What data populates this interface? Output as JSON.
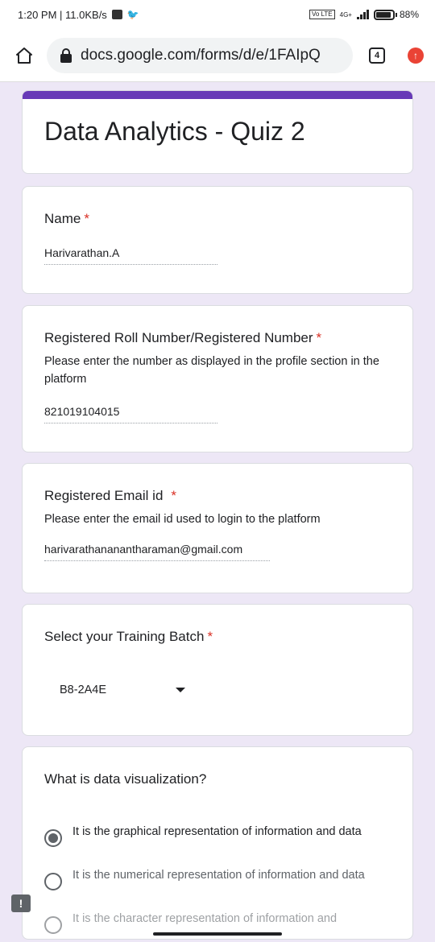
{
  "status_bar": {
    "time": "1:20 PM | 11.0KB/s",
    "network": "4G+",
    "volte": "Vo LTE",
    "battery": "88%"
  },
  "browser": {
    "url": "docs.google.com/forms/d/e/1FAIpQ",
    "tab_count": "4"
  },
  "form": {
    "title": "Data Analytics - Quiz 2",
    "required_marker": "*",
    "name": {
      "label": "Name",
      "value": "Harivarathan.A"
    },
    "roll": {
      "label": "Registered Roll Number/Registered Number",
      "description": "Please enter the number as displayed in the profile section in the platform",
      "value": "821019104015"
    },
    "email": {
      "label": "Registered Email id",
      "description": "Please enter the email id used to login to the platform",
      "value": "harivarathananantharaman@gmail.com"
    },
    "batch": {
      "label": "Select your Training Batch",
      "selected": "B8-2A4E"
    },
    "viz": {
      "label": "What is data visualization?",
      "options": [
        {
          "text": "It is the graphical representation of information and data",
          "selected": true
        },
        {
          "text": "It is the numerical representation of information and data",
          "selected": false
        },
        {
          "text": "It is the character representation of information and",
          "selected": false
        }
      ]
    }
  },
  "colors": {
    "accent": "#673ab7",
    "background": "#ede7f6",
    "required": "#d93025"
  }
}
